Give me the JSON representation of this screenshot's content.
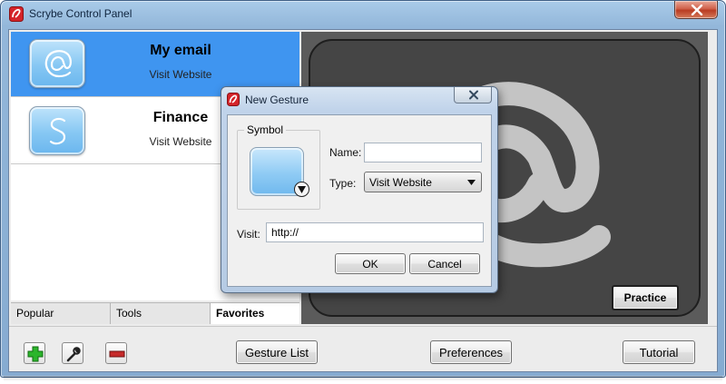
{
  "window": {
    "title": "Scrybe Control Panel"
  },
  "gestures": [
    {
      "title": "My email",
      "action": "Visit Website",
      "symbol": "at-sign-icon",
      "selected": true
    },
    {
      "title": "Finance",
      "action": "Visit Website",
      "symbol": "s-letter-icon",
      "selected": false
    }
  ],
  "tabs": [
    {
      "label": "Popular",
      "active": false
    },
    {
      "label": "Tools",
      "active": false
    },
    {
      "label": "Favorites",
      "active": true
    }
  ],
  "preview": {
    "gesture_symbol": "at-sign-icon",
    "practice_label": "Practice"
  },
  "toolbar": {
    "add_icon": "plus-icon",
    "edit_icon": "wrench-icon",
    "remove_icon": "minus-icon",
    "gesture_list_label": "Gesture List",
    "preferences_label": "Preferences",
    "tutorial_label": "Tutorial"
  },
  "dialog": {
    "title": "New Gesture",
    "symbol_label": "Symbol",
    "name_label": "Name:",
    "name_value": "",
    "type_label": "Type:",
    "type_value": "Visit Website",
    "visit_label": "Visit:",
    "visit_value": "http://",
    "ok_label": "OK",
    "cancel_label": "Cancel"
  },
  "colors": {
    "selection": "#3f95f0",
    "preview_bg": "#454545",
    "gesture_stroke": "#c4c4c4",
    "add_green": "#2bb52b",
    "remove_red": "#c62a2a",
    "app_icon_red": "#d4242a"
  }
}
